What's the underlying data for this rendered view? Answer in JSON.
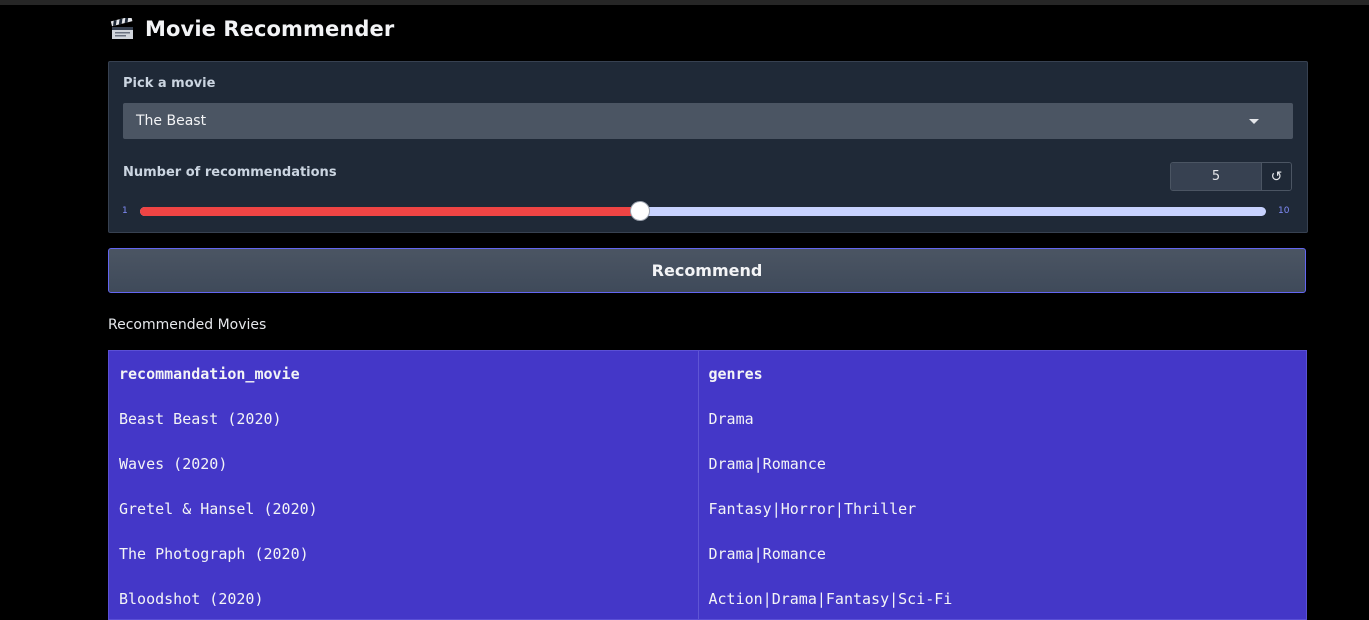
{
  "app": {
    "title": "Movie Recommender",
    "title_icon": "clapperboard-icon"
  },
  "controls": {
    "pick_label": "Pick a movie",
    "selected_movie": "The Beast",
    "num_label": "Number of recommendations",
    "num_value": "5",
    "reset_symbol": "↺",
    "slider": {
      "min": "1",
      "max": "10",
      "value": 5,
      "fill_color": "#ef4444",
      "track_color": "#c7d2fe"
    }
  },
  "recommend_button": {
    "label": "Recommend"
  },
  "results": {
    "label": "Recommended Movies",
    "columns": [
      "recommandation_movie",
      "genres"
    ],
    "rows": [
      [
        "Beast Beast (2020)",
        "Drama"
      ],
      [
        "Waves (2020)",
        "Drama|Romance"
      ],
      [
        "Gretel & Hansel (2020)",
        "Fantasy|Horror|Thriller"
      ],
      [
        "The Photograph (2020)",
        "Drama|Romance"
      ],
      [
        "Bloodshot (2020)",
        "Action|Drama|Fantasy|Sci-Fi"
      ]
    ],
    "table_color": "#4437c8"
  }
}
